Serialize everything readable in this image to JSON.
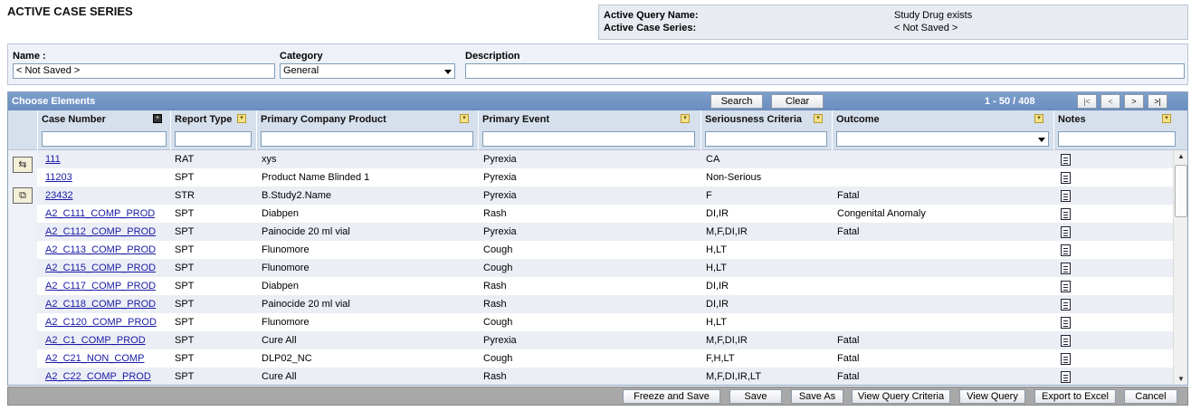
{
  "page": {
    "title": "ACTIVE CASE SERIES"
  },
  "query_info": {
    "query_name_label": "Active Query Name:",
    "query_name_value": "Study Drug exists",
    "case_series_label": "Active Case Series:",
    "case_series_value": "< Not Saved >"
  },
  "criteria": {
    "name_label": "Name :",
    "name_value": "< Not Saved >",
    "category_label": "Category",
    "category_value": "General",
    "description_label": "Description",
    "description_value": ""
  },
  "grid": {
    "title": "Choose Elements",
    "search_label": "Search",
    "clear_label": "Clear",
    "pager_text": "1 - 50 / 408",
    "pager_buttons": {
      "first": "|<",
      "prev": "<",
      "next": ">",
      "last": ">|"
    },
    "columns": [
      "Case Number",
      "Report Type",
      "Primary Company Product",
      "Primary Event",
      "Seriousness Criteria",
      "Outcome",
      "Notes"
    ],
    "rows": [
      {
        "case": "111",
        "type": "RAT",
        "product": "xys",
        "event": "Pyrexia",
        "seriousness": "CA",
        "outcome": ""
      },
      {
        "case": "11203",
        "type": "SPT",
        "product": "Product Name Blinded 1",
        "event": "Pyrexia",
        "seriousness": "Non-Serious",
        "outcome": ""
      },
      {
        "case": "23432",
        "type": "STR",
        "product": "B.Study2.Name",
        "event": "Pyrexia",
        "seriousness": "F",
        "outcome": "Fatal"
      },
      {
        "case": "A2_C111_COMP_PROD",
        "type": "SPT",
        "product": "Diabpen",
        "event": "Rash",
        "seriousness": "DI,IR",
        "outcome": "Congenital Anomaly"
      },
      {
        "case": "A2_C112_COMP_PROD",
        "type": "SPT",
        "product": "Painocide 20 ml vial",
        "event": "Pyrexia",
        "seriousness": "M,F,DI,IR",
        "outcome": "Fatal"
      },
      {
        "case": "A2_C113_COMP_PROD",
        "type": "SPT",
        "product": "Flunomore",
        "event": "Cough",
        "seriousness": "H,LT",
        "outcome": ""
      },
      {
        "case": "A2_C115_COMP_PROD",
        "type": "SPT",
        "product": "Flunomore",
        "event": "Cough",
        "seriousness": "H,LT",
        "outcome": ""
      },
      {
        "case": "A2_C117_COMP_PROD",
        "type": "SPT",
        "product": "Diabpen",
        "event": "Rash",
        "seriousness": "DI,IR",
        "outcome": ""
      },
      {
        "case": "A2_C118_COMP_PROD",
        "type": "SPT",
        "product": "Painocide 20 ml vial",
        "event": "Rash",
        "seriousness": "DI,IR",
        "outcome": ""
      },
      {
        "case": "A2_C120_COMP_PROD",
        "type": "SPT",
        "product": "Flunomore",
        "event": "Cough",
        "seriousness": "H,LT",
        "outcome": ""
      },
      {
        "case": "A2_C1_COMP_PROD",
        "type": "SPT",
        "product": "Cure All",
        "event": "Pyrexia",
        "seriousness": "M,F,DI,IR",
        "outcome": "Fatal"
      },
      {
        "case": "A2_C21_NON_COMP",
        "type": "SPT",
        "product": "DLP02_NC",
        "event": "Cough",
        "seriousness": "F,H,LT",
        "outcome": "Fatal"
      },
      {
        "case": "A2_C22_COMP_PROD",
        "type": "SPT",
        "product": "Cure All",
        "event": "Rash",
        "seriousness": "M,F,DI,IR,LT",
        "outcome": "Fatal"
      }
    ]
  },
  "footer": {
    "buttons": [
      "Freeze and Save",
      "Save",
      "Save As",
      "View Query Criteria",
      "View Query",
      "Export to Excel",
      "Cancel"
    ]
  },
  "icons": {
    "sort": "sort-icon",
    "note": "notes-icon",
    "side_1": "add-to-series-icon",
    "side_2": "copy-series-icon"
  }
}
